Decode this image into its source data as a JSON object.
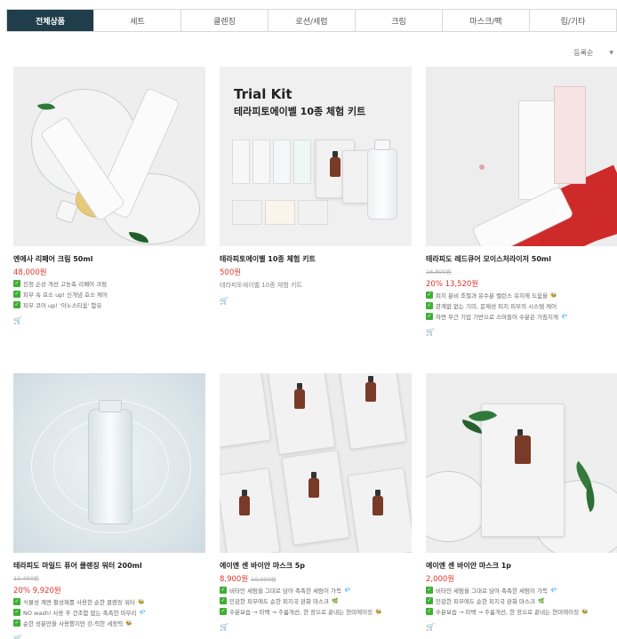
{
  "tabs": [
    "전체상품",
    "세트",
    "클렌징",
    "로션/세럼",
    "크림",
    "마스크/팩",
    "립/기타"
  ],
  "sort": {
    "label": "등록순"
  },
  "products": [
    {
      "name": "엔에사 리페어 크림 50ml",
      "price": "48,000원",
      "features": [
        "진정 손상 개선 고농축 리페어 크림",
        "피부 속 효소 up! 신개념 효소 케어",
        "피부 코어 up! '이노스티움' 함유"
      ],
      "feature_emoji": [
        "",
        "",
        ""
      ]
    },
    {
      "name": "테라피토에이벨 10종 체험 키트",
      "price": "500원",
      "description": "테라피토에이벨 10종 체험 키트",
      "image_title": "Trial Kit",
      "image_subtitle": "테라피토에이벨 10종 체험 키트"
    },
    {
      "name": "테라피도 레드큐어 모이스처라이저 50ml",
      "original_price": "16,800원",
      "price": "20% 13,520원",
      "features": [
        "피지 분비 조절과 유수분 밸런스 유지에 도움을",
        "관계없 없는 기미, 문제성 피지 피부의 시스템 케어",
        "하면 무근 기업 기반으로 스며들어 수분은 거침지게"
      ],
      "feature_emoji": [
        "🐝",
        "",
        "💎"
      ]
    },
    {
      "name": "테라피도 마일드 퓨어 클렌징 워터 200ml",
      "original_price": "12,400원",
      "price": "20% 9,920원",
      "features": [
        "식물성 계면 활성제를 사용한 순한 클렌징 워터",
        "NO wash! 사용 후 건조함 없는 촉촉한 마무리",
        "순한 성분만을 사용했지만 강-력한 세정력"
      ],
      "feature_emoji": [
        "🐝",
        "💎",
        "🐝"
      ]
    },
    {
      "name": "에이엔 센 바이안 마스크 5p",
      "price": "8,900원",
      "inline_original_price": "10,000원",
      "features": [
        "비타민 세럼을 그대로 담아 촉촉한 세럼이 가득",
        "민감한 피부에도 순한 피지국 완화 마스크",
        "수분보습 → 미백 → 주름개선, 한 장으로 끝내는 현미에이징"
      ],
      "feature_emoji": [
        "💎",
        "🌿",
        "🐝"
      ]
    },
    {
      "name": "에이엔 센 바이안 마스크 1p",
      "price": "2,000원",
      "features": [
        "비타민 세럼을 그대로 담아 촉촉한 세럼이 가득",
        "민감한 피부에도 순한 피지국 완화 마스크",
        "수분보습 → 미백 → 주름개선, 한 장으로 끝내는 현미에이징"
      ],
      "feature_emoji": [
        "💎",
        "🌿",
        "🐝"
      ]
    }
  ],
  "colors": {
    "tab_active": "#1f3d4a",
    "price": "#e0352b",
    "check": "#3fae35"
  },
  "icons": {
    "cart": "cart-icon",
    "check": "check-icon",
    "sort_caret": "chevron-down-icon"
  }
}
